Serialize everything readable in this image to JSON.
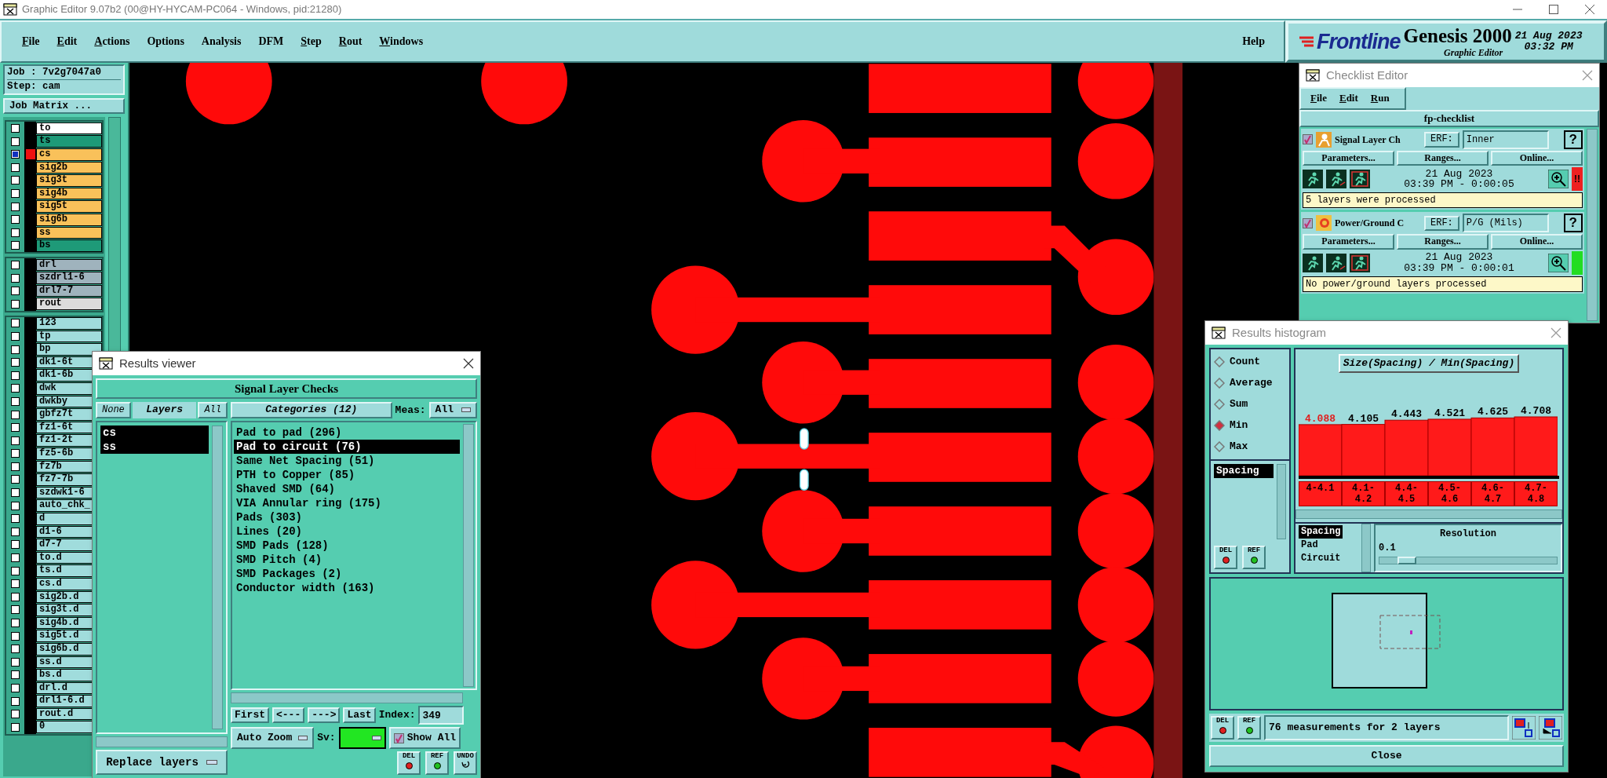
{
  "window": {
    "title": "Graphic Editor 9.07b2 (00@HY-HYCAM-PC064 - Windows, pid:21280)"
  },
  "menu": [
    {
      "label": "File",
      "underlined": true
    },
    {
      "label": "Edit",
      "underlined": true
    },
    {
      "label": "Actions",
      "underlined": true
    },
    {
      "label": "Options",
      "underlined": false
    },
    {
      "label": "Analysis",
      "underlined": false
    },
    {
      "label": "DFM",
      "underlined": false
    },
    {
      "label": "Step",
      "underlined": true
    },
    {
      "label": "Rout",
      "underlined": true
    },
    {
      "label": "Windows",
      "underlined": true
    }
  ],
  "help": "Help",
  "brand": {
    "logo": "Frontline",
    "product": "Genesis 2000",
    "subtitle": "Graphic Editor",
    "date": "21 Aug 2023",
    "time": "03:32 PM"
  },
  "job": {
    "job": "Job : 7v2g7047a0",
    "step": "Step: cam",
    "matrix_button": "Job Matrix ..."
  },
  "layer_groups": [
    [
      {
        "name": "to",
        "color": "#ffffff",
        "selected": false
      },
      {
        "name": "ts",
        "color": "#1e9a78",
        "selected": false
      },
      {
        "name": "cs",
        "color": "#f9c15a",
        "selected": true
      },
      {
        "name": "sig2b",
        "color": "#f9c15a",
        "selected": false
      },
      {
        "name": "sig3t",
        "color": "#f9c15a",
        "selected": false
      },
      {
        "name": "sig4b",
        "color": "#f9c15a",
        "selected": false
      },
      {
        "name": "sig5t",
        "color": "#f9c15a",
        "selected": false
      },
      {
        "name": "sig6b",
        "color": "#f9c15a",
        "selected": false
      },
      {
        "name": "ss",
        "color": "#f9c15a",
        "selected": false
      },
      {
        "name": "bs",
        "color": "#1e9a78",
        "selected": false
      }
    ],
    [
      {
        "name": "drl",
        "color": "#9fb3bd",
        "selected": false
      },
      {
        "name": "szdrl1-6",
        "color": "#9fb3bd",
        "selected": false
      },
      {
        "name": "drl7-7",
        "color": "#9fb3bd",
        "selected": false
      },
      {
        "name": "rout",
        "color": "#dcdcdc",
        "selected": false
      }
    ],
    [
      {
        "name": "123",
        "color": "#a0dcdc",
        "selected": false
      },
      {
        "name": "tp",
        "color": "#a0dcdc",
        "selected": false
      },
      {
        "name": "bp",
        "color": "#a0dcdc",
        "selected": false
      },
      {
        "name": "dk1-6t",
        "color": "#a0dcdc",
        "selected": false
      },
      {
        "name": "dk1-6b",
        "color": "#a0dcdc",
        "selected": false
      },
      {
        "name": "dwk",
        "color": "#a0dcdc",
        "selected": false
      },
      {
        "name": "dwkby",
        "color": "#a0dcdc",
        "selected": false
      },
      {
        "name": "gbfz7t",
        "color": "#a0dcdc",
        "selected": false
      },
      {
        "name": "fz1-6t",
        "color": "#a0dcdc",
        "selected": false
      },
      {
        "name": "fz1-2t",
        "color": "#a0dcdc",
        "selected": false
      },
      {
        "name": "fz5-6b",
        "color": "#a0dcdc",
        "selected": false
      },
      {
        "name": "fz7b",
        "color": "#a0dcdc",
        "selected": false
      },
      {
        "name": "fz7-7b",
        "color": "#a0dcdc",
        "selected": false
      },
      {
        "name": "szdwk1-6",
        "color": "#a0dcdc",
        "selected": false
      },
      {
        "name": "auto_chk_",
        "color": "#a0dcdc",
        "selected": false
      },
      {
        "name": "d",
        "color": "#a0dcdc",
        "selected": false
      },
      {
        "name": "d1-6",
        "color": "#a0dcdc",
        "selected": false
      },
      {
        "name": "d7-7",
        "color": "#a0dcdc",
        "selected": false
      },
      {
        "name": "to.d",
        "color": "#a0dcdc",
        "selected": false
      },
      {
        "name": "ts.d",
        "color": "#a0dcdc",
        "selected": false
      },
      {
        "name": "cs.d",
        "color": "#a0dcdc",
        "selected": false
      },
      {
        "name": "sig2b.d",
        "color": "#a0dcdc",
        "selected": false
      },
      {
        "name": "sig3t.d",
        "color": "#a0dcdc",
        "selected": false
      },
      {
        "name": "sig4b.d",
        "color": "#a0dcdc",
        "selected": false
      },
      {
        "name": "sig5t.d",
        "color": "#a0dcdc",
        "selected": false
      },
      {
        "name": "sig6b.d",
        "color": "#a0dcdc",
        "selected": false
      },
      {
        "name": "ss.d",
        "color": "#a0dcdc",
        "selected": false
      },
      {
        "name": "bs.d",
        "color": "#a0dcdc",
        "selected": false
      },
      {
        "name": "drl.d",
        "color": "#a0dcdc",
        "selected": false
      },
      {
        "name": "drl1-6.d",
        "color": "#a0dcdc",
        "selected": false
      },
      {
        "name": "rout.d",
        "color": "#a0dcdc",
        "selected": false
      },
      {
        "name": "0",
        "color": "#a0dcdc",
        "selected": false
      }
    ]
  ],
  "results_viewer": {
    "title": "Results viewer",
    "header": "Signal Layer Checks",
    "none_button": "None",
    "layers_button": "Layers",
    "all_button": "All",
    "layers": [
      {
        "name": "cs",
        "selected": true
      },
      {
        "name": "ss",
        "selected": true
      }
    ],
    "replace": "Replace layers",
    "categories_button": "Categories (12)",
    "meas_label": "Meas:",
    "meas_value": "All",
    "categories": [
      {
        "label": "Pad to pad (296)",
        "selected": false
      },
      {
        "label": "Pad to circuit (76)",
        "selected": true
      },
      {
        "label": "Same Net Spacing (51)",
        "selected": false
      },
      {
        "label": "PTH to Copper (85)",
        "selected": false
      },
      {
        "label": "Shaved SMD (64)",
        "selected": false
      },
      {
        "label": "VIA Annular ring (175)",
        "selected": false
      },
      {
        "label": "Pads (303)",
        "selected": false
      },
      {
        "label": "Lines (20)",
        "selected": false
      },
      {
        "label": "SMD Pads (128)",
        "selected": false
      },
      {
        "label": "SMD Pitch (4)",
        "selected": false
      },
      {
        "label": "SMD Packages (2)",
        "selected": false
      },
      {
        "label": "Conductor width (163)",
        "selected": false
      }
    ],
    "nav": [
      "First",
      "<---",
      "--->",
      "Last"
    ],
    "index_label": "Index:",
    "index_value": "349",
    "zoom": "Auto Zoom",
    "sv_label": "Sv:",
    "show_all": {
      "label": "Show All",
      "checked": true
    },
    "tools": [
      {
        "label": "DEL",
        "kind": "dot",
        "color": "#e02020"
      },
      {
        "label": "REF",
        "kind": "dot",
        "color": "#20c020"
      },
      {
        "label": "UNDO",
        "kind": "arrow"
      }
    ]
  },
  "checklist": {
    "title": "Checklist Editor",
    "menu": [
      "File",
      "Edit",
      "Run"
    ],
    "name": "fp-checklist",
    "actions": [
      {
        "kind": "signal",
        "checked": true,
        "title": "Signal Layer Ch",
        "erf_label": "ERF:",
        "erf": "Inner",
        "help": "?",
        "buttons": [
          "Parameters...",
          "Ranges...",
          "Online..."
        ],
        "date": "21 Aug 2023",
        "time": "03:39 PM - 0:00:05",
        "color": "#ee2020",
        "alert": "!!",
        "message": "5 layers were processed"
      },
      {
        "kind": "power",
        "checked": true,
        "title": "Power/Ground C",
        "erf_label": "ERF:",
        "erf": "P/G (Mils)",
        "help": "?",
        "buttons": [
          "Parameters...",
          "Ranges...",
          "Online..."
        ],
        "date": "21 Aug 2023",
        "time": "03:39 PM - 0:00:01",
        "color": "#22dd22",
        "message": "No power/ground layers processed"
      }
    ]
  },
  "histogram": {
    "title": "Results histogram",
    "modes": [
      {
        "label": "Count",
        "selected": false
      },
      {
        "label": "Average",
        "selected": false
      },
      {
        "label": "Sum",
        "selected": false
      },
      {
        "label": "Min",
        "selected": true
      },
      {
        "label": "Max",
        "selected": false
      }
    ],
    "measures": [
      {
        "label": "Spacing",
        "selected": true
      }
    ],
    "chart_data": {
      "type": "bar",
      "title": "Size(Spacing) / Min(Spacing)",
      "categories": [
        "4-4.1",
        "4.1-4.2",
        "4.4-4.5",
        "4.5-4.6",
        "4.6-4.7",
        "4.7-4.8"
      ],
      "values": [
        4.088,
        4.105,
        4.443,
        4.521,
        4.625,
        4.708
      ],
      "value_labels": [
        "4.088",
        "4.105",
        "4.443",
        "4.521",
        "4.625",
        "4.708"
      ],
      "data_labels": true
    },
    "bars": [
      {
        "highlighted": true
      },
      {
        "highlighted": false
      },
      {
        "highlighted": false
      },
      {
        "highlighted": false
      },
      {
        "highlighted": false
      },
      {
        "highlighted": false
      }
    ],
    "types": [
      {
        "label": "Spacing",
        "selected": true
      },
      {
        "label": "Pad",
        "selected": false
      },
      {
        "label": "Circuit",
        "selected": false
      }
    ],
    "resolution_label": "Resolution",
    "resolution_value": "0.1",
    "resolution_slider": {
      "level": 0.1
    },
    "list_tools": [
      {
        "label": "DEL",
        "color": "#e02020"
      },
      {
        "label": "REF",
        "color": "#20c020"
      }
    ],
    "footer_tools": [
      {
        "label": "DEL",
        "color": "#e02020"
      },
      {
        "label": "REF",
        "color": "#20c020"
      }
    ],
    "message": "76 measurements for 2 layers",
    "close": "Close"
  }
}
